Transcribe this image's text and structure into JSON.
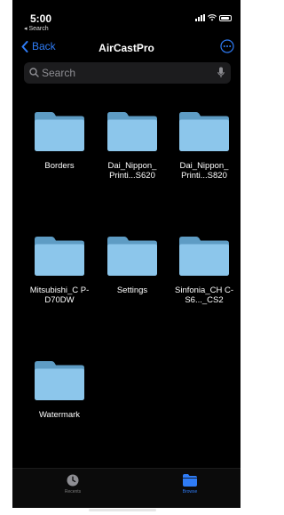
{
  "status_bar": {
    "time": "5:00",
    "back_app": "◂ Search"
  },
  "nav": {
    "back_label": "Back",
    "title": "AirCastPro",
    "accent_color": "#2f7cf6"
  },
  "search": {
    "placeholder": "Search"
  },
  "folders": [
    {
      "name": "Borders",
      "icon": "folder-icon"
    },
    {
      "name": "Dai_Nippon_ Printi...S620",
      "icon": "folder-icon"
    },
    {
      "name": "Dai_Nippon_ Printi...S820",
      "icon": "folder-icon"
    },
    {
      "name": "Mitsubishi_C P-D70DW",
      "icon": "folder-icon"
    },
    {
      "name": "Settings",
      "icon": "folder-icon"
    },
    {
      "name": "Sinfonia_CH C-S6..._CS2",
      "icon": "folder-icon"
    },
    {
      "name": "Watermark",
      "icon": "folder-icon"
    }
  ],
  "tab_bar": {
    "recents_label": "Recents",
    "browse_label": "Browse"
  }
}
